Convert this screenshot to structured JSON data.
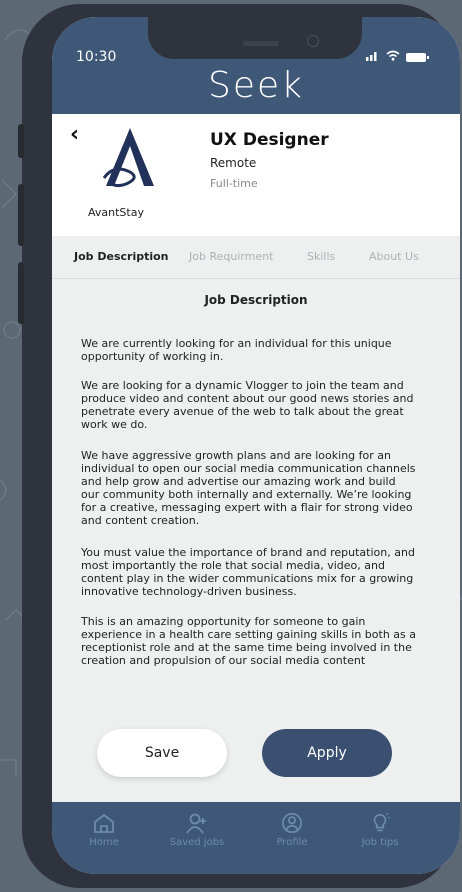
{
  "status_bar": {
    "time": "10:30"
  },
  "app": {
    "logo": "Seek"
  },
  "job": {
    "company": "AvantStay",
    "title": "UX Designer",
    "location": "Remote",
    "type": "Full-time"
  },
  "tabs": [
    {
      "label": "Job Description",
      "active": true
    },
    {
      "label": "Job Requirment",
      "active": false
    },
    {
      "label": "Skills",
      "active": false
    },
    {
      "label": "About Us",
      "active": false
    }
  ],
  "description": {
    "title": "Job Description",
    "paragraphs": [
      "We are currently looking for an individual for this unique opportunity of working in.",
      "We are looking for a dynamic Vlogger to join the team and produce video and content about our good news stories and penetrate every avenue of the web to talk about the great work we do.",
      "We have aggressive growth plans and are looking for an individual to open our social media communication channels and help grow and advertise our amazing work and build our community both internally and externally. We’re looking for a creative, messaging expert with a flair for strong video and content creation.",
      "You must value the importance of brand and reputation, and most importantly the role that social media, video, and content play in the wider communications mix for a growing innovative technology-driven business.",
      "This is an amazing opportunity for someone to gain experience in a health care setting gaining skills in both as a receptionist role and at the same time being involved in the creation and propulsion of our social media content"
    ]
  },
  "actions": {
    "save_label": "Save",
    "apply_label": "Apply"
  },
  "nav": [
    {
      "label": "Home",
      "icon": "home-icon"
    },
    {
      "label": "Saved jobs",
      "icon": "saved-jobs-icon"
    },
    {
      "label": "Profile",
      "icon": "profile-icon"
    },
    {
      "label": "Job tips",
      "icon": "lightbulb-icon"
    }
  ],
  "colors": {
    "primary": "#3f5878",
    "apply": "#3b5070",
    "nav_inactive": "#6f8ba9",
    "tab_inactive": "#aeb1b4"
  }
}
